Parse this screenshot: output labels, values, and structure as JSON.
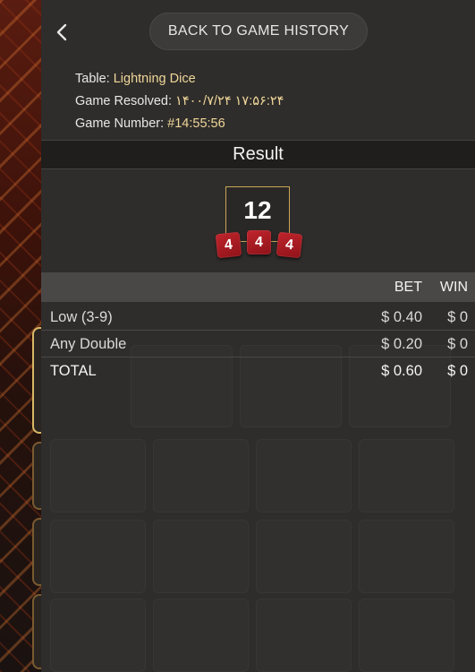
{
  "header": {
    "back_label": "BACK TO GAME HISTORY"
  },
  "info": {
    "table_label": "Table:",
    "table_value": "Lightning Dice",
    "resolved_label": "Game Resolved:",
    "resolved_value": "۱۴۰۰/۷/۲۴ ۱۷:۵۶:۲۴",
    "number_label": "Game Number:",
    "number_value": "#14:55:56"
  },
  "result": {
    "heading": "Result",
    "total": "12",
    "dice": [
      "4",
      "4",
      "4"
    ]
  },
  "bets": {
    "columns": {
      "bet": "BET",
      "win": "WIN"
    },
    "rows": [
      {
        "name": "Low (3-9)",
        "bet": "$ 0.40",
        "win": "$ 0"
      },
      {
        "name": "Any Double",
        "bet": "$ 0.20",
        "win": "$ 0"
      }
    ],
    "total": {
      "name": "TOTAL",
      "bet": "$ 0.60",
      "win": "$ 0"
    }
  },
  "colors": {
    "accent_gold": "#f0d79a",
    "frame_gold": "#c9a65a",
    "die_red": "#b51f27",
    "panel_bg": "#2f2d2b"
  },
  "icons": {
    "back": "chevron-left-icon"
  }
}
